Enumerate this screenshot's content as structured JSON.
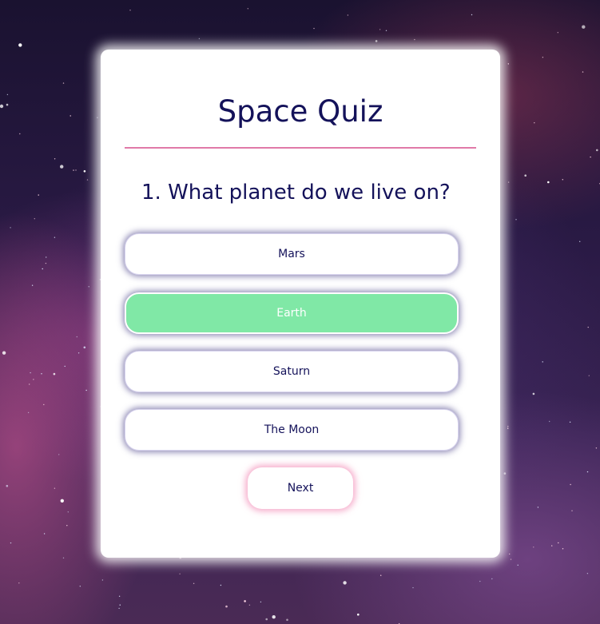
{
  "quiz": {
    "title": "Space Quiz",
    "question": "1. What planet do we live on?",
    "answers": [
      {
        "label": "Mars",
        "selected": false
      },
      {
        "label": "Earth",
        "selected": true
      },
      {
        "label": "Saturn",
        "selected": false
      },
      {
        "label": "The Moon",
        "selected": false
      }
    ],
    "next_label": "Next"
  },
  "colors": {
    "text": "#14125a",
    "divider": "#e07aa8",
    "selected_answer": "#80e8a6",
    "next_glow": "#f078aa"
  }
}
